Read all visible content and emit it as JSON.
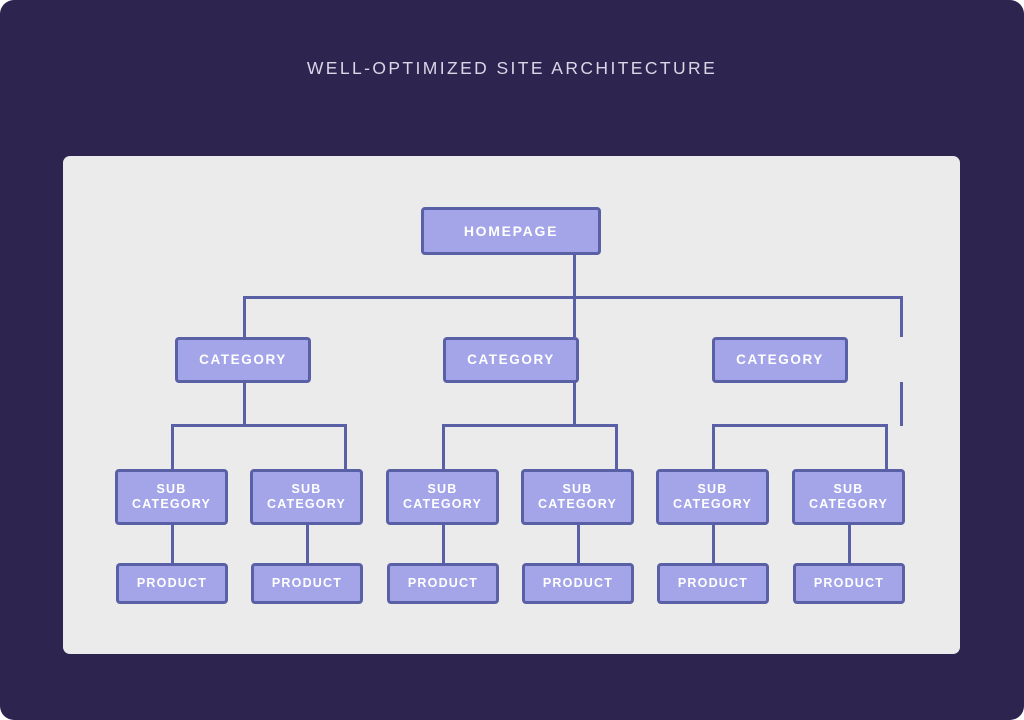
{
  "title": "WELL-OPTIMIZED SITE ARCHITECTURE",
  "colors": {
    "background": "#2E2450",
    "panel": "#EBEBEB",
    "node_fill": "#A4A5E8",
    "node_border": "#5A60A6",
    "node_text": "#FFFFFF",
    "title_text": "#D9D6E6",
    "connector": "#5A60A6"
  },
  "chart_data": {
    "type": "diagram",
    "title": "WELL-OPTIMIZED SITE ARCHITECTURE",
    "structure": "tree",
    "levels": [
      "Homepage",
      "Category",
      "Sub Category",
      "Product"
    ],
    "nodes": {
      "homepage": {
        "label": "HOMEPAGE"
      },
      "categories": [
        {
          "label": "CATEGORY"
        },
        {
          "label": "CATEGORY"
        },
        {
          "label": "CATEGORY"
        }
      ],
      "subcategories": [
        {
          "line1": "SUB",
          "line2": "CATEGORY"
        },
        {
          "line1": "SUB",
          "line2": "CATEGORY"
        },
        {
          "line1": "SUB",
          "line2": "CATEGORY"
        },
        {
          "line1": "SUB",
          "line2": "CATEGORY"
        },
        {
          "line1": "SUB",
          "line2": "CATEGORY"
        },
        {
          "line1": "SUB",
          "line2": "CATEGORY"
        }
      ],
      "products": [
        {
          "label": "PRODUCT"
        },
        {
          "label": "PRODUCT"
        },
        {
          "label": "PRODUCT"
        },
        {
          "label": "PRODUCT"
        },
        {
          "label": "PRODUCT"
        },
        {
          "label": "PRODUCT"
        }
      ]
    },
    "edges": [
      {
        "from": "homepage",
        "to": "categories.0"
      },
      {
        "from": "homepage",
        "to": "categories.1"
      },
      {
        "from": "homepage",
        "to": "categories.2"
      },
      {
        "from": "categories.0",
        "to": "subcategories.0"
      },
      {
        "from": "categories.0",
        "to": "subcategories.1"
      },
      {
        "from": "categories.1",
        "to": "subcategories.2"
      },
      {
        "from": "categories.1",
        "to": "subcategories.3"
      },
      {
        "from": "categories.2",
        "to": "subcategories.4"
      },
      {
        "from": "categories.2",
        "to": "subcategories.5"
      },
      {
        "from": "subcategories.0",
        "to": "products.0"
      },
      {
        "from": "subcategories.1",
        "to": "products.1"
      },
      {
        "from": "subcategories.2",
        "to": "products.2"
      },
      {
        "from": "subcategories.3",
        "to": "products.3"
      },
      {
        "from": "subcategories.4",
        "to": "products.4"
      },
      {
        "from": "subcategories.5",
        "to": "products.5"
      }
    ]
  }
}
